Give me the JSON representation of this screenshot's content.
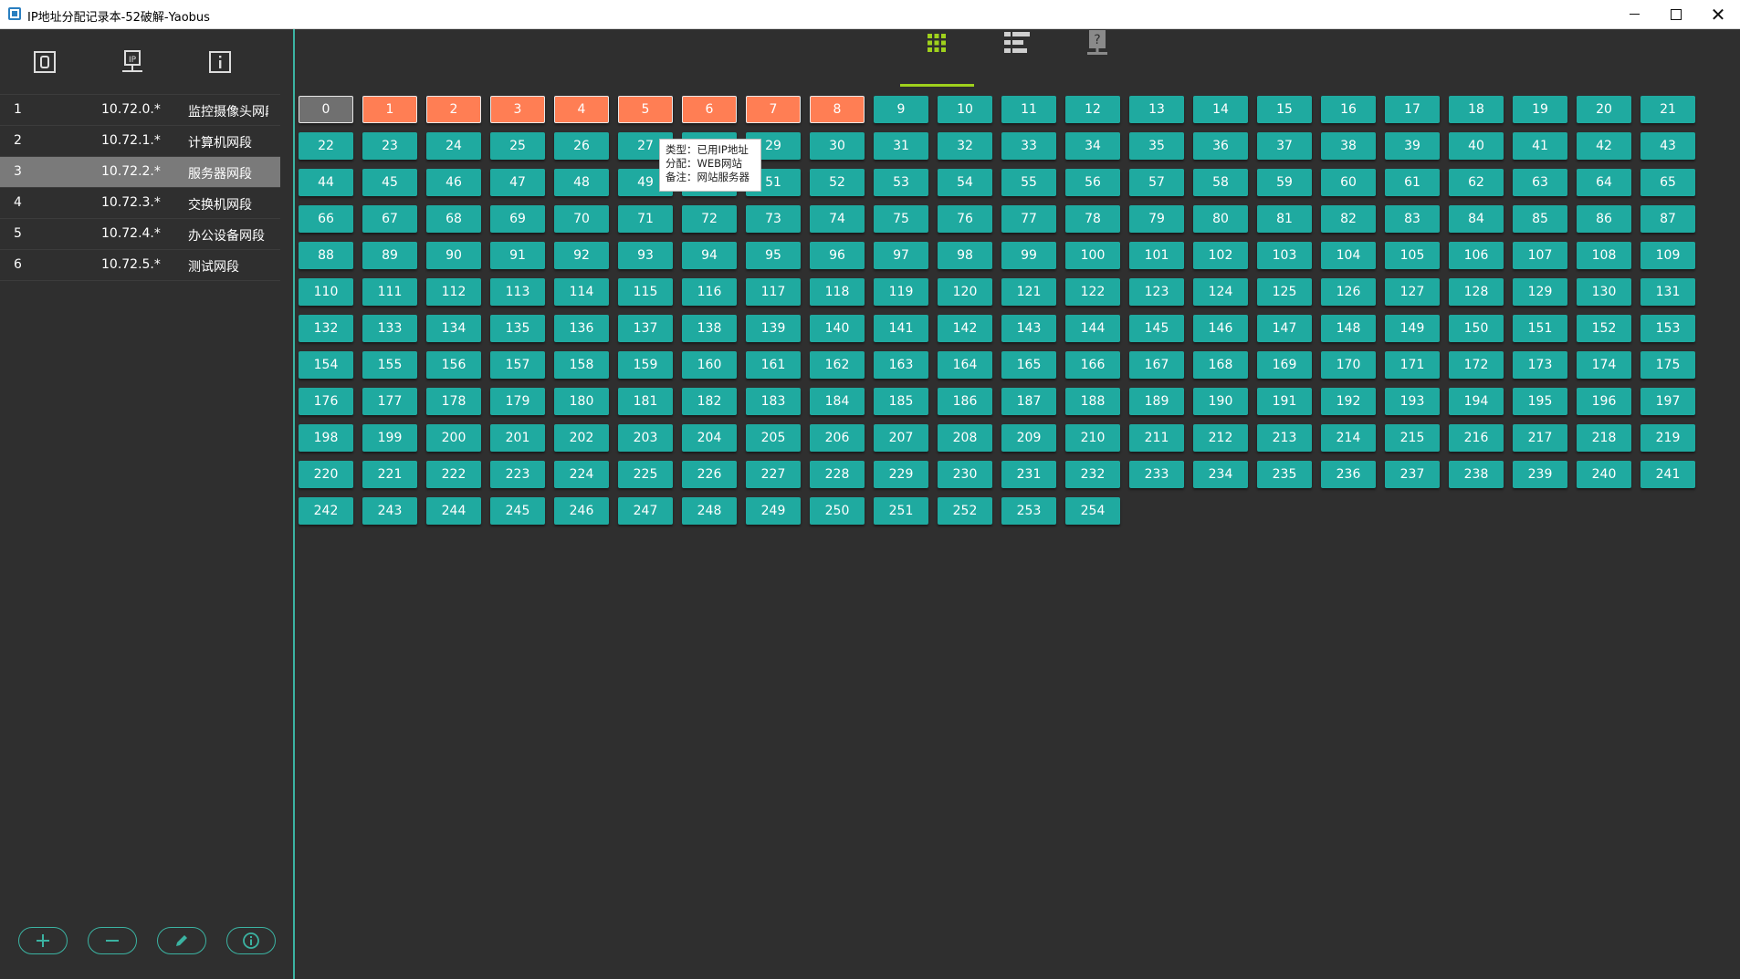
{
  "window": {
    "title": "IP地址分配记录本-52破解-Yaobus",
    "close_glyph": "✕"
  },
  "sidebar": {
    "top_icons": [
      "zero-box-icon",
      "ip-network-icon",
      "info-box-icon"
    ],
    "rows": [
      {
        "index": "1",
        "ip": "10.72.0.*",
        "name": "监控摄像头网段"
      },
      {
        "index": "2",
        "ip": "10.72.1.*",
        "name": "计算机网段"
      },
      {
        "index": "3",
        "ip": "10.72.2.*",
        "name": "服务器网段"
      },
      {
        "index": "4",
        "ip": "10.72.3.*",
        "name": "交换机网段"
      },
      {
        "index": "5",
        "ip": "10.72.4.*",
        "name": "办公设备网段"
      },
      {
        "index": "6",
        "ip": "10.72.5.*",
        "name": "测试网段"
      }
    ],
    "selected_row": 2,
    "bottom_buttons": [
      "add-icon",
      "remove-icon",
      "edit-icon",
      "info-icon"
    ]
  },
  "tabs": [
    {
      "icon": "grid-view-icon",
      "active": true
    },
    {
      "icon": "list-view-icon",
      "active": false
    },
    {
      "icon": "unknown-host-icon",
      "active": false
    }
  ],
  "ip_grid": {
    "count": 255,
    "gateway": [
      0
    ],
    "used": [
      1,
      2,
      3,
      4,
      5,
      6,
      7,
      8
    ]
  },
  "tooltip": {
    "type_line": "类型：已用IP地址",
    "assign_line": "分配：WEB网站",
    "note_line": "备注：网站服务器"
  },
  "colors": {
    "accent": "#3bb3a2",
    "free": "#1faaa0",
    "used": "#ff7e54",
    "gateway": "#707070",
    "active_tab": "#9fd11c",
    "background": "#2f2f2f"
  }
}
